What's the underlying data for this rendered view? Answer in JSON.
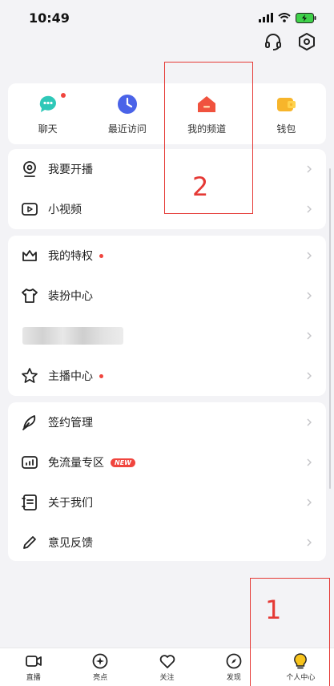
{
  "status": {
    "time": "10:49"
  },
  "quick_actions": [
    {
      "label": "聊天",
      "icon": "chat-bubble-icon",
      "color": "#2fc8b8",
      "dot": true
    },
    {
      "label": "最近访问",
      "icon": "clock-icon",
      "color": "#4a63e8",
      "dot": false
    },
    {
      "label": "我的频道",
      "icon": "house-icon",
      "color": "#f0523e",
      "dot": false
    },
    {
      "label": "钱包",
      "icon": "wallet-icon",
      "color": "#f7b52b",
      "dot": false
    }
  ],
  "menu_a": [
    {
      "label": "我要开播",
      "icon": "broadcast-icon"
    },
    {
      "label": "小视频",
      "icon": "video-play-icon"
    }
  ],
  "menu_b": [
    {
      "label": "我的特权",
      "icon": "crown-icon",
      "dot": true
    },
    {
      "label": "装扮中心",
      "icon": "tshirt-icon"
    },
    {
      "label": "",
      "icon": ""
    },
    {
      "label": "主播中心",
      "icon": "star-icon",
      "dot": true
    }
  ],
  "menu_c": [
    {
      "label": "签约管理",
      "icon": "feather-icon"
    },
    {
      "label": "免流量专区",
      "icon": "data-chart-icon",
      "badge": "NEW"
    },
    {
      "label": "关于我们",
      "icon": "document-icon"
    },
    {
      "label": "意见反馈",
      "icon": "pencil-icon"
    }
  ],
  "tabs": [
    {
      "label": "直播",
      "icon": "camera-icon"
    },
    {
      "label": "亮点",
      "icon": "spark-icon"
    },
    {
      "label": "关注",
      "icon": "heart-icon"
    },
    {
      "label": "发现",
      "icon": "compass-icon"
    },
    {
      "label": "个人中心",
      "icon": "bulb-icon",
      "active": true
    }
  ],
  "annotations": [
    {
      "number": "1"
    },
    {
      "number": "2"
    }
  ],
  "colors": {
    "accent": "#f0453e",
    "active_tab": "#f7c31c",
    "annotation": "#e53935"
  }
}
